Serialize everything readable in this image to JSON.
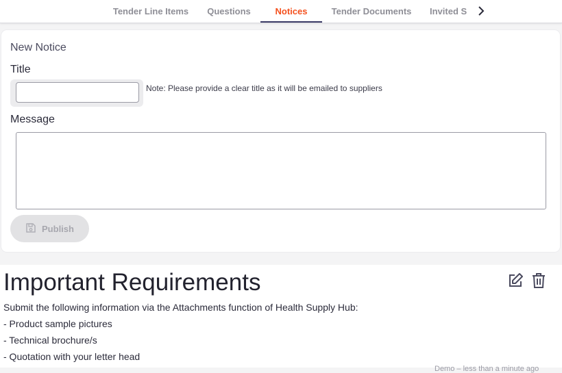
{
  "tabs": [
    {
      "label": "Tender Line Items",
      "active": false
    },
    {
      "label": "Questions",
      "active": false
    },
    {
      "label": "Notices",
      "active": true
    },
    {
      "label": "Tender Documents",
      "active": false
    },
    {
      "label": "Invited S",
      "active": false
    }
  ],
  "new_notice": {
    "heading": "New Notice",
    "title_label": "Title",
    "title_value": "",
    "title_note": "Note: Please provide a clear title as it will be emailed to suppliers",
    "message_label": "Message",
    "message_value": "",
    "publish_label": "Publish"
  },
  "notice": {
    "title": "Important Requirements",
    "lines": [
      "Submit the following information via the Attachments function of Health Supply Hub:",
      "- Product sample pictures",
      "- Technical brochure/s",
      "- Quotation with your letter head"
    ],
    "meta": "Demo – less than a minute ago"
  },
  "icons": {
    "tab_scroll": "chevron-right-icon",
    "publish": "save-icon",
    "edit": "edit-icon",
    "delete": "trash-icon"
  },
  "colors": {
    "active_tab": "#f4511e",
    "tab_underline": "#3a3a66"
  }
}
